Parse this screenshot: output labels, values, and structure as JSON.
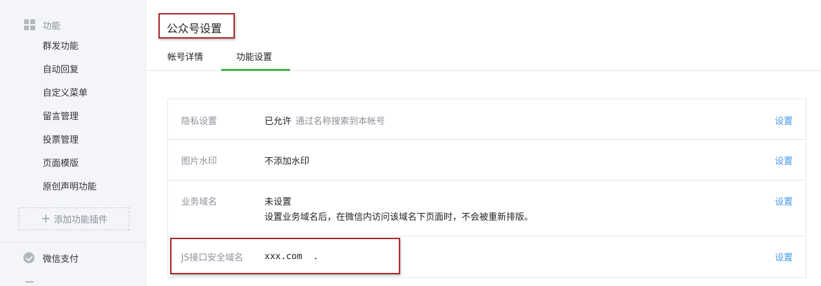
{
  "sidebar": {
    "group_title": "功能",
    "items": [
      {
        "label": "群发功能"
      },
      {
        "label": "自动回复"
      },
      {
        "label": "自定义菜单"
      },
      {
        "label": "留言管理"
      },
      {
        "label": "投票管理"
      },
      {
        "label": "页面模版"
      },
      {
        "label": "原创声明功能"
      }
    ],
    "add_plugin_label": "添加功能插件",
    "add_plugin_icon": "+",
    "pay_label": "微信支付"
  },
  "main": {
    "title": "公众号设置",
    "tabs": [
      {
        "label": "帐号详情"
      },
      {
        "label": "功能设置",
        "active": true
      }
    ],
    "rows": [
      {
        "label": "隐私设置",
        "value": "已允许",
        "hint": "通过名称搜索到本帐号",
        "action": "设置"
      },
      {
        "label": "图片水印",
        "value": "不添加水印",
        "action": "设置"
      },
      {
        "label": "业务域名",
        "value": "未设置",
        "desc": "设置业务域名后，在微信内访问该域名下页面时，不会被重新排版。",
        "action": "设置"
      },
      {
        "label": "JS接口安全域名",
        "value": "xxx.com  .",
        "action": "设置"
      }
    ]
  },
  "colors": {
    "sidebar_bg": "#f4f5f9",
    "active_tab": "#44b549",
    "link": "#459ae9",
    "highlight_border": "#a8282c"
  }
}
